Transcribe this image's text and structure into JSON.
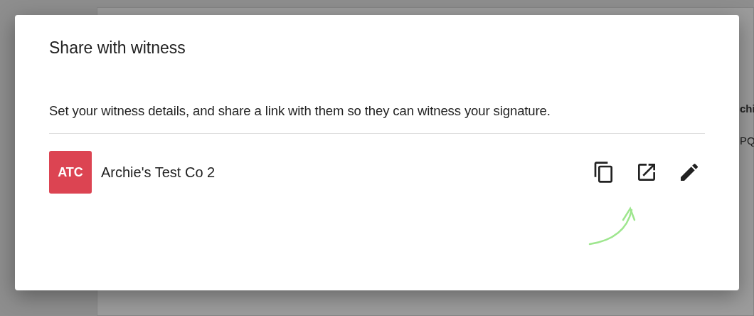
{
  "background": {
    "texts": [
      "chi",
      "PQ"
    ]
  },
  "dialog": {
    "title": "Share with witness",
    "description": "Set your witness details, and share a link with them so they can witness your signature.",
    "witness": {
      "initials": "ATC",
      "name": "Archie's Test Co 2"
    },
    "actions": [
      {
        "kind": "copy"
      },
      {
        "kind": "open"
      },
      {
        "kind": "edit"
      }
    ]
  }
}
